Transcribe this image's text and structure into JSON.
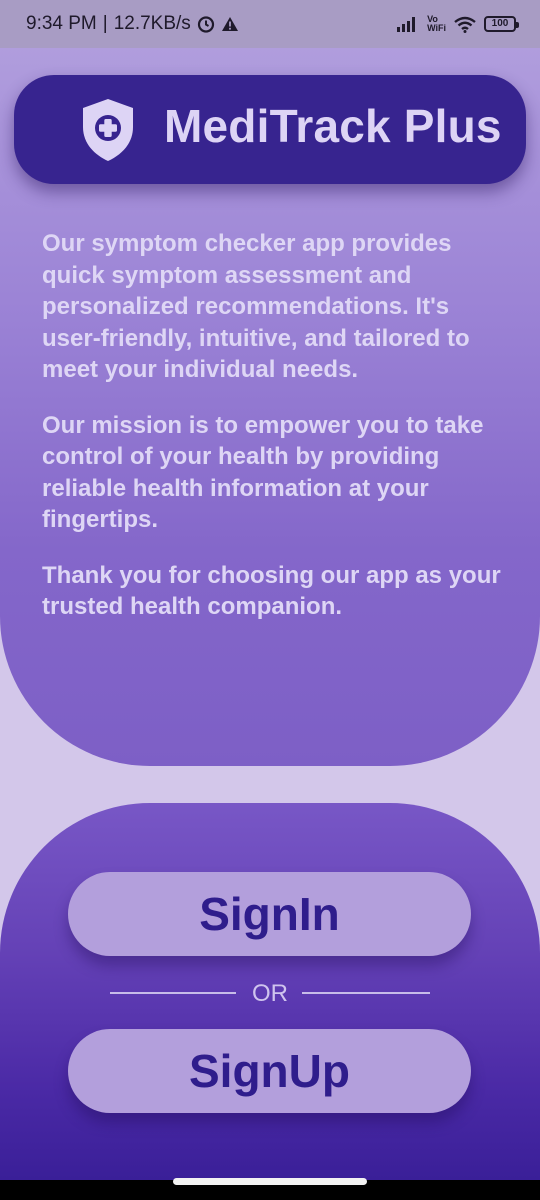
{
  "status_bar": {
    "time": "9:34 PM",
    "separator": "|",
    "speed": "12.7KB/s",
    "vowifi_top": "Vo",
    "vowifi_bottom": "WiFi",
    "battery": "100",
    "icons": [
      "alarm-icon",
      "warning-icon",
      "signal-icon",
      "wifi-icon",
      "battery-icon"
    ]
  },
  "header": {
    "title": "MediTrack Plus",
    "logo_icon": "shield-plus-icon"
  },
  "description": {
    "paragraph_1": "Our symptom checker app provides quick symptom assessment and personalized recommendations. It's user-friendly, intuitive, and tailored to meet your individual needs.",
    "paragraph_2": "Our mission is to empower you to take control of your health by providing reliable health information at your fingertips.",
    "paragraph_3": "Thank you for choosing our app as your trusted health companion."
  },
  "auth": {
    "signin_label": "SignIn",
    "or_label": "OR",
    "signup_label": "SignUp"
  },
  "colors": {
    "header_bg": "#37248f",
    "button_bg": "#b39fdc",
    "button_text": "#2f1d8c",
    "background": "#d3c7ea"
  }
}
